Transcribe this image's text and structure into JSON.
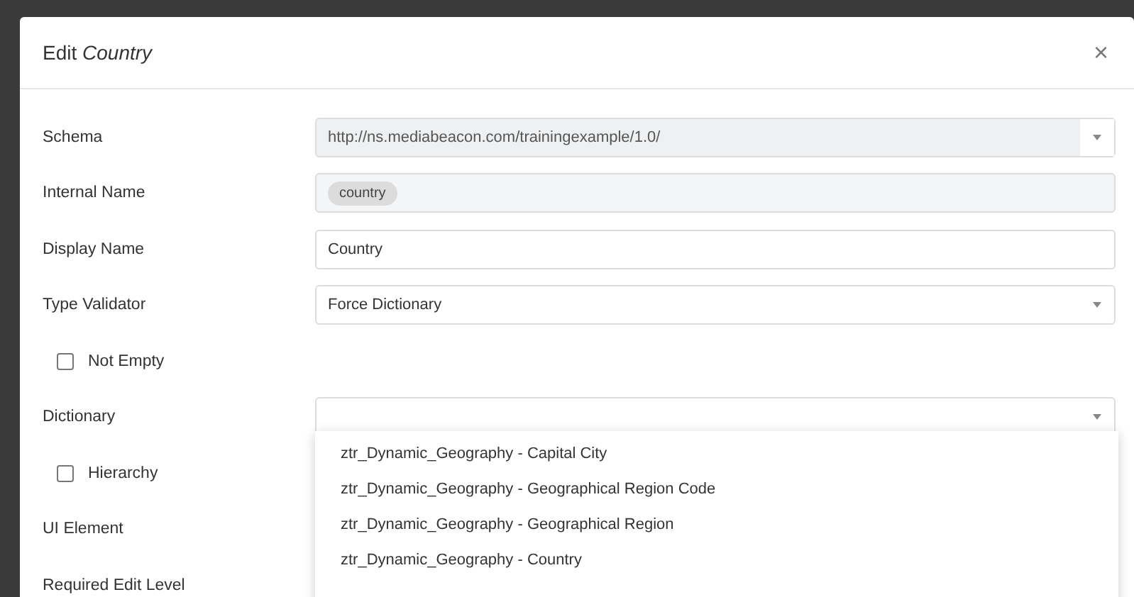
{
  "dialog": {
    "title": "Edit *Country*",
    "close": "×"
  },
  "fields": [
    {
      "kind": "select",
      "label": "Schema",
      "value": "http://ns.mediabeacon.com/trainingexample/1.0/",
      "disabled": true
    },
    {
      "kind": "tag",
      "label": "Internal Name",
      "value": "country"
    },
    {
      "kind": "text",
      "label": "Display Name",
      "value": "Country"
    },
    {
      "kind": "select",
      "label": "Type Validator",
      "value": "Force Dictionary",
      "disabled": false
    },
    {
      "kind": "checkbox",
      "label": "Not Empty",
      "checked": false
    },
    {
      "kind": "select",
      "label": "Dictionary",
      "disabled": false
    },
    {
      "kind": "checkbox",
      "label": "Hierarchy",
      "checked": false
    },
    {
      "kind": "label",
      "label": "UI Element"
    },
    {
      "kind": "label",
      "label": "Required Edit Level"
    }
  ],
  "dropdown": {
    "items": [
      "ztr_Dynamic_Geography - Capital City",
      "ztr_Dynamic_Geography - Geographical Region Code",
      "ztr_Dynamic_Geography - Geographical Region",
      "ztr_Dynamic_Geography - Country"
    ]
  }
}
